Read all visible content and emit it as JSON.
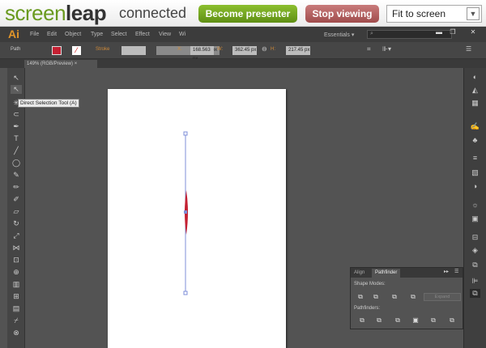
{
  "screenleap": {
    "logo_light": "screen",
    "logo_bold": "leap",
    "status": "connected",
    "become_presenter": "Become presenter",
    "stop_viewing": "Stop viewing",
    "view_mode": "Fit to screen",
    "brand_color": "#6a9a1f"
  },
  "illustrator": {
    "app_logo": "Ai",
    "menu": [
      "File",
      "Edit",
      "Object",
      "Type",
      "Select",
      "Effect",
      "View",
      "Wi"
    ],
    "workspace": "Essentials",
    "control": {
      "selection": "Path",
      "stroke_label": "Stroke",
      "stroke_unit": "px",
      "x_label": "X:",
      "x": "168.563 px",
      "w_label": "W:",
      "w": "362.45 px",
      "h_label": "H:",
      "h": "217.45 px",
      "fill_color": "#c42032"
    },
    "doc_tab": "149% (RGB/Preview)",
    "tooltip": "Direct Selection Tool (A)",
    "panel": {
      "tabs": [
        "Align",
        "Pathfinder"
      ],
      "shape_modes": "Shape Modes:",
      "expand": "Expand",
      "pathfinders": "Pathfinders:"
    }
  }
}
